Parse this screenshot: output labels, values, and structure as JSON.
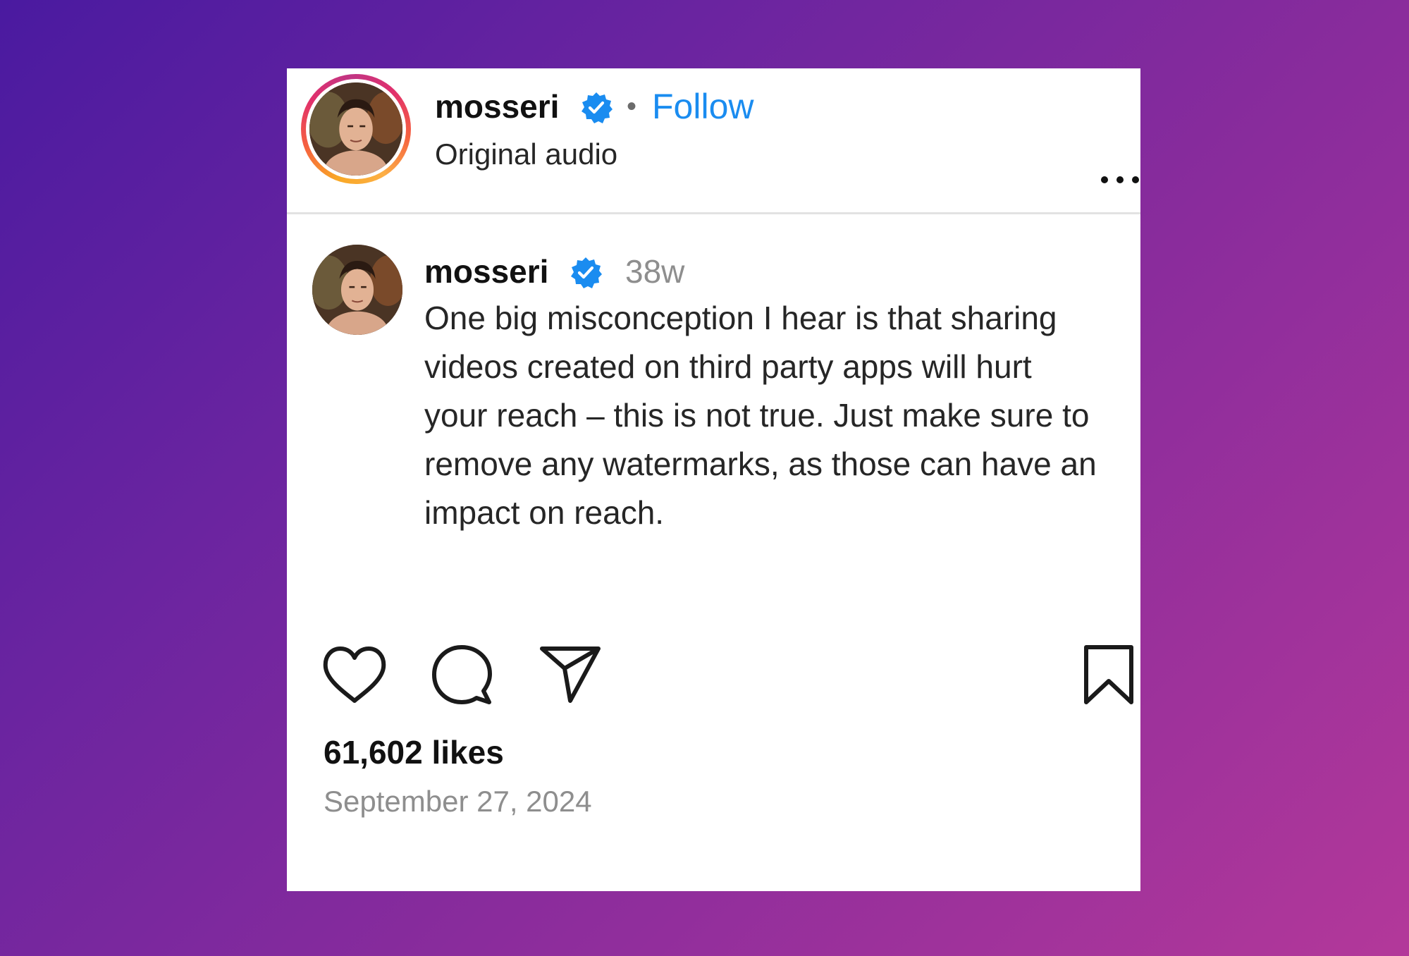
{
  "header": {
    "username": "mosseri",
    "separator": "•",
    "follow_label": "Follow",
    "audio_label": "Original audio"
  },
  "caption": {
    "username": "mosseri",
    "time_ago": "38w",
    "text": "One big misconception I hear is that sharing videos created on third party apps will hurt your reach – this is not true. Just make sure to remove any watermarks, as those can have an impact on reach."
  },
  "stats": {
    "likes": "61,602 likes",
    "date": "September 27, 2024"
  },
  "icons": {
    "verified": "verified-badge-icon",
    "more": "more-options-icon",
    "like": "heart-icon",
    "comment": "comment-bubble-icon",
    "share": "paper-plane-icon",
    "save": "bookmark-icon"
  },
  "colors": {
    "follow": "#1a8cf0",
    "verified": "#1a8cf0",
    "text_primary": "#111111",
    "text_secondary": "#8e8e8e",
    "background_start": "#4a1aa0",
    "background_end": "#b3389a"
  }
}
